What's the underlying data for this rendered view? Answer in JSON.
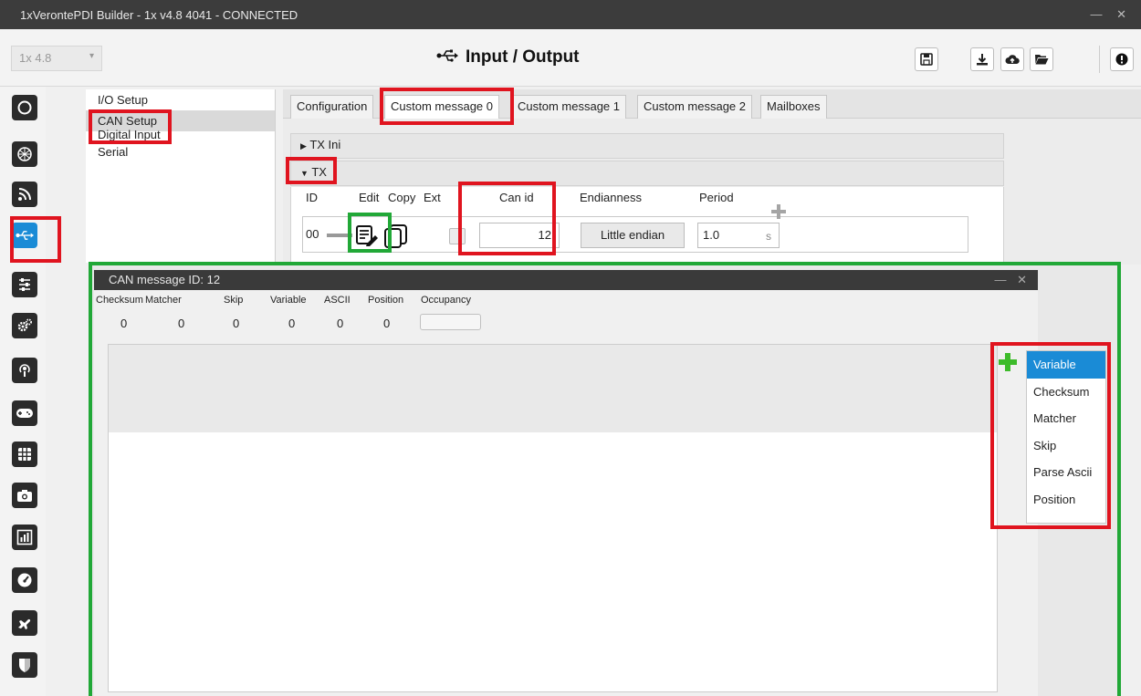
{
  "window": {
    "title": "1xVerontePDI Builder - 1x v4.8 4041 - CONNECTED",
    "controls": "— ✕"
  },
  "header": {
    "version": "1x 4.8",
    "title": "Input / Output",
    "toolbar_icons": [
      "save-icon",
      "download-icon",
      "cloud-upload-icon",
      "folder-open-icon",
      "info-icon"
    ]
  },
  "sidebar_icons": [
    "power-icon",
    "globe-icon",
    "signal-icon",
    "usb-icon",
    "sliders-icon",
    "gears-icon",
    "podcast-icon",
    "gamepad-icon",
    "grid-icon",
    "camera-icon",
    "chart-icon",
    "dashboard-icon",
    "airplane-icon",
    "shield-icon"
  ],
  "nav": {
    "items": [
      "I/O Setup",
      "CAN Setup",
      "Digital Input",
      "Serial"
    ],
    "selected": "CAN Setup"
  },
  "tabs": [
    "Configuration",
    "Custom message 0",
    "Custom message 1",
    "Custom message 2",
    "Mailboxes"
  ],
  "active_tab": "Custom message 0",
  "sections": {
    "tx_ini": "TX Ini",
    "tx": "TX",
    "tx_ini_arrow": "▶",
    "tx_arrow": "▼"
  },
  "tx_table": {
    "headers": {
      "id": "ID",
      "edit": "Edit",
      "copy": "Copy",
      "ext": "Ext",
      "can_id": "Can id",
      "endianness": "Endianness",
      "period": "Period"
    },
    "row": {
      "id": "00",
      "can_id": "12",
      "endianness": "Little endian",
      "period": "1.0",
      "period_unit": "s"
    }
  },
  "dialog": {
    "title": "CAN message ID: 12",
    "stats": {
      "labels": [
        "Checksum",
        "Matcher",
        "Skip",
        "Variable",
        "ASCII",
        "Position",
        "Occupancy"
      ],
      "values": [
        "0",
        "0",
        "0",
        "0",
        "0",
        "0"
      ]
    }
  },
  "add_menu": {
    "items": [
      "Variable",
      "Checksum",
      "Matcher",
      "Skip",
      "Parse Ascii",
      "Position"
    ],
    "selected": "Variable"
  },
  "colors": {
    "highlight_red": "#e0141f",
    "highlight_green": "#21a837",
    "accent_blue": "#1a8bd6",
    "add_green": "#3dbb2a"
  }
}
